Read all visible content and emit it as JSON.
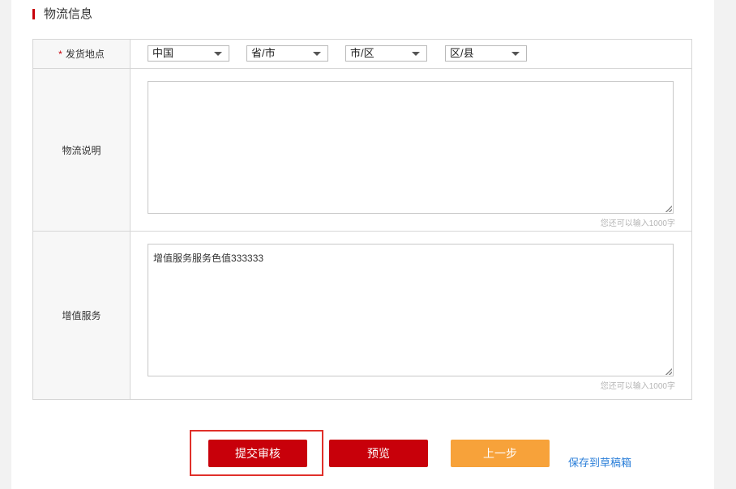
{
  "section": {
    "title": "物流信息"
  },
  "ship_from": {
    "label": "发货地点",
    "required_mark": "*",
    "country": "中国",
    "province": "省/市",
    "city": "市/区",
    "district": "区/县"
  },
  "logistics_note": {
    "label": "物流说明",
    "value": "",
    "hint": "您还可以输入1000字"
  },
  "value_added": {
    "label": "增值服务",
    "value": "增值服务服务色值333333",
    "hint": "您还可以输入1000字"
  },
  "actions": {
    "submit": "提交审核",
    "preview": "预览",
    "prev_step": "上一步",
    "save_draft": "保存到草稿箱"
  },
  "colors": {
    "primary_red": "#c8000a",
    "orange": "#f7a23a",
    "link_blue": "#2b7fd9",
    "highlight_border": "#e0302a"
  }
}
